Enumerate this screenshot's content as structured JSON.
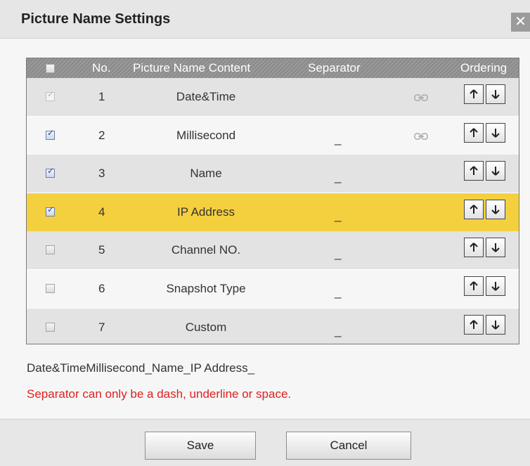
{
  "dialog": {
    "title": "Picture Name Settings",
    "close_symbol": "✕"
  },
  "table": {
    "headers": {
      "number": "No.",
      "content": "Picture Name Content",
      "separator": "Separator",
      "ordering": "Ordering"
    },
    "rows": [
      {
        "no": "1",
        "content": "Date&Time",
        "separator": "",
        "checked": true,
        "disabled": true,
        "linked": true,
        "selected": false
      },
      {
        "no": "2",
        "content": "Millisecond",
        "separator": "_",
        "checked": true,
        "disabled": false,
        "linked": true,
        "selected": false
      },
      {
        "no": "3",
        "content": "Name",
        "separator": "_",
        "checked": true,
        "disabled": false,
        "linked": false,
        "selected": false
      },
      {
        "no": "4",
        "content": "IP Address",
        "separator": "_",
        "checked": true,
        "disabled": false,
        "linked": false,
        "selected": true
      },
      {
        "no": "5",
        "content": "Channel NO.",
        "separator": "_",
        "checked": false,
        "disabled": false,
        "linked": false,
        "selected": false
      },
      {
        "no": "6",
        "content": "Snapshot Type",
        "separator": "_",
        "checked": false,
        "disabled": false,
        "linked": false,
        "selected": false
      },
      {
        "no": "7",
        "content": "Custom",
        "separator": "_",
        "checked": false,
        "disabled": false,
        "linked": false,
        "selected": false
      }
    ]
  },
  "preview": "Date&TimeMillisecond_Name_IP Address_",
  "warning": "Separator can only be a dash, underline or space.",
  "buttons": {
    "save": "Save",
    "cancel": "Cancel"
  },
  "colors": {
    "selected_row": "#f4d03f",
    "warning_text": "#e02020",
    "header_bg": "#919191"
  },
  "icons": {
    "close": "close-icon",
    "link": "link-icon",
    "up": "arrow-up-icon",
    "down": "arrow-down-icon",
    "check": "checkmark-icon"
  }
}
